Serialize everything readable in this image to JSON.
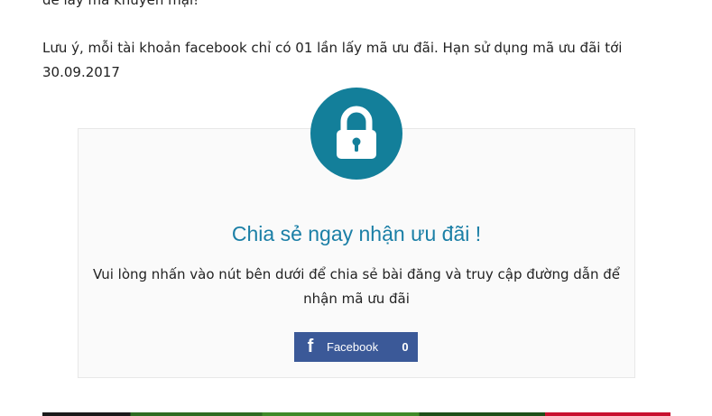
{
  "article": {
    "intro_tail": "để lấy mã khuyến mại!",
    "note": "Lưu ý, mỗi tài khoản facebook chỉ có 01 lần lấy mã ưu đãi. Hạn sử dụng mã ưu đãi tới 30.09.2017"
  },
  "locker": {
    "icon": "lock-icon",
    "title": "Chia sẻ ngay nhận ưu đãi !",
    "message": "Vui lòng nhấn vào nút bên dưới để chia sẻ bài đăng và truy cập đường dẫn để nhận mã ưu đãi",
    "accent_color": "#137f9a",
    "share_button": {
      "icon": "facebook-icon",
      "label": "Facebook",
      "count": "0",
      "color": "#3b5998"
    }
  }
}
